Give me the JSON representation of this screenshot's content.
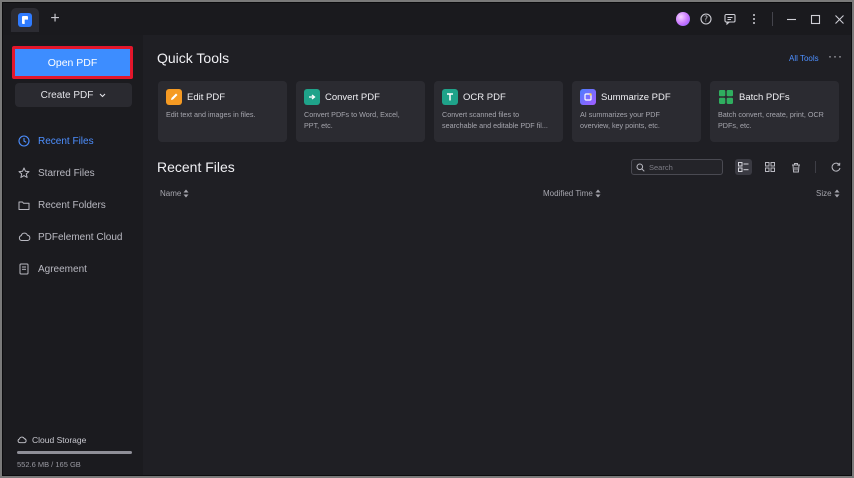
{
  "titlebar": {
    "new_tab_symbol": "+",
    "icons": [
      "avatar",
      "help-icon",
      "feedback-icon",
      "more-vertical-icon",
      "minimize-icon",
      "maximize-icon",
      "close-icon"
    ]
  },
  "sidebar": {
    "open_pdf_label": "Open PDF",
    "create_pdf_label": "Create PDF",
    "items": [
      {
        "label": "Recent Files",
        "icon": "clock-icon",
        "active": true
      },
      {
        "label": "Starred Files",
        "icon": "star-icon",
        "active": false
      },
      {
        "label": "Recent Folders",
        "icon": "folder-icon",
        "active": false
      },
      {
        "label": "PDFelement Cloud",
        "icon": "cloud-icon",
        "active": false
      },
      {
        "label": "Agreement",
        "icon": "document-icon",
        "active": false
      }
    ],
    "storage": {
      "title": "Cloud Storage",
      "usage_text": "552.6 MB / 165 GB",
      "fill_fraction": 0.003
    }
  },
  "quick_tools": {
    "title": "Quick Tools",
    "all_tools_label": "All Tools",
    "more_label": "···",
    "cards": [
      {
        "title": "Edit PDF",
        "desc": "Edit text and images in files.",
        "color": "#f59a23"
      },
      {
        "title": "Convert PDF",
        "desc": "Convert PDFs to Word, Excel,\nPPT, etc.",
        "color": "#1fa38a"
      },
      {
        "title": "OCR PDF",
        "desc": "Convert scanned files to\nsearchable and editable PDF fil...",
        "color": "#1fa38a"
      },
      {
        "title": "Summarize PDF",
        "desc": "AI summarizes your PDF\noverview, key points, etc.",
        "color": "#7a5cff"
      },
      {
        "title": "Batch PDFs",
        "desc": "Batch convert, create, print, OCR\nPDFs, etc.",
        "color": "#2fae5f"
      }
    ]
  },
  "recent_files": {
    "title": "Recent Files",
    "search_placeholder": "Search",
    "columns": {
      "name": "Name",
      "modified": "Modified Time",
      "size": "Size"
    }
  },
  "colors": {
    "accent": "#3d8dff",
    "highlight_border": "#e3162b",
    "background": "#1f1f24"
  }
}
